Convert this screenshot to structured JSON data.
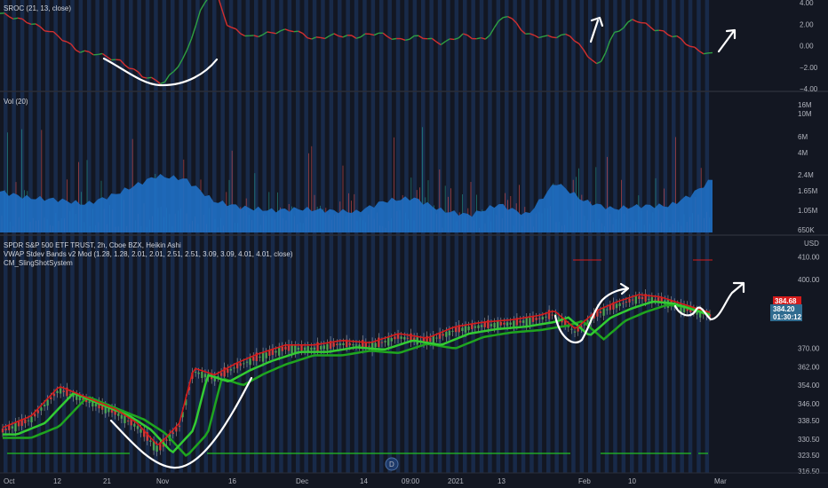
{
  "panes": {
    "sroc": {
      "title": "SROC (21, 13, close)"
    },
    "volume": {
      "title": "Vol (20)"
    },
    "price": {
      "title": "SPDR S&P 500 ETF TRUST, 2h, Cboe BZX, Heikin Ashi",
      "subtitle1": "VWAP Stdev Bands v2 Mod (1.28, 1.28, 2.01, 2.01, 2.51, 2.51, 3.09, 3.09, 4.01, 4.01, close)",
      "subtitle2": "CM_SlingShotSystem",
      "currency": "USD",
      "last_price_label": "384.68",
      "current_price_label": "384.20",
      "countdown_label": "01:30:12"
    }
  },
  "time_axis": {
    "labels": [
      "Oct",
      "12",
      "21",
      "Nov",
      "16",
      "Dec",
      "14",
      "09:00",
      "2021",
      "13",
      "Feb",
      "10",
      "Mar"
    ],
    "badge": "D"
  },
  "colors": {
    "background": "#131722",
    "stripe": "#1e3a6a",
    "sroc_up": "#2ea043",
    "sroc_down": "#d32f2f",
    "volume_fill": "#2962ff",
    "volume_up_bar": "#26a69a",
    "volume_down_bar": "#ef5350",
    "ema_fast": "#33cc33",
    "ema_slow": "#1fa51f",
    "price_red": "#d61b1b",
    "annotation": "#ffffff",
    "grid": "#2a2e39"
  },
  "chart_data": [
    {
      "type": "line",
      "name": "SROC (21, 13, close)",
      "x": [
        0,
        0.04,
        0.08,
        0.11,
        0.14,
        0.17,
        0.2,
        0.23,
        0.26,
        0.28,
        0.3,
        0.32,
        0.35,
        0.38,
        0.41,
        0.44,
        0.47,
        0.5,
        0.53,
        0.56,
        0.59,
        0.62,
        0.65,
        0.68,
        0.71,
        0.74,
        0.77,
        0.8,
        0.82,
        0.84,
        0.86,
        0.89,
        0.92,
        0.95,
        0.98,
        1.0
      ],
      "values": [
        3.0,
        2.2,
        1.0,
        -0.5,
        -0.8,
        -1.5,
        -2.8,
        -3.5,
        -1.0,
        3.0,
        5.5,
        1.8,
        0.8,
        1.2,
        1.5,
        0.6,
        1.0,
        0.8,
        1.2,
        0.5,
        0.9,
        0.2,
        1.0,
        0.5,
        3.0,
        1.0,
        0.8,
        1.0,
        -0.5,
        -2.0,
        1.0,
        2.5,
        1.5,
        0.8,
        -0.5,
        -0.8
      ],
      "ylim": [
        -4.0,
        4.0
      ],
      "yticks": [
        4.0,
        2.0,
        0.0,
        -2.0,
        -4.0
      ],
      "ytick_labels": [
        "4.00",
        "2.00",
        "0.00",
        "−2.00",
        "−4.00"
      ]
    },
    {
      "type": "area",
      "name": "Vol (20)",
      "x": [
        0,
        0.04,
        0.08,
        0.12,
        0.16,
        0.2,
        0.22,
        0.26,
        0.3,
        0.34,
        0.38,
        0.42,
        0.46,
        0.5,
        0.54,
        0.58,
        0.62,
        0.66,
        0.7,
        0.74,
        0.78,
        0.82,
        0.86,
        0.9,
        0.94,
        0.97,
        1.0
      ],
      "values": [
        1.3,
        1.1,
        1.05,
        0.9,
        1.2,
        1.6,
        1.8,
        1.7,
        1.0,
        0.8,
        0.7,
        0.75,
        0.7,
        0.65,
        1.0,
        1.1,
        0.7,
        0.55,
        0.9,
        0.55,
        1.6,
        1.0,
        0.75,
        0.85,
        0.85,
        1.2,
        1.7
      ],
      "yticks": [
        "16M",
        "10M",
        "6M",
        "4M",
        "2.4M",
        "1.65M",
        "1.05M",
        "650K"
      ]
    },
    {
      "type": "line",
      "name": "SPDR S&P 500 ETF TRUST, 2h, Cboe BZX, Heikin Ashi",
      "x": [
        0,
        0.04,
        0.08,
        0.12,
        0.16,
        0.19,
        0.22,
        0.25,
        0.27,
        0.3,
        0.33,
        0.36,
        0.4,
        0.44,
        0.48,
        0.52,
        0.56,
        0.6,
        0.64,
        0.68,
        0.72,
        0.76,
        0.78,
        0.81,
        0.84,
        0.87,
        0.9,
        0.93,
        0.96,
        1.0
      ],
      "values": [
        334,
        339,
        352,
        347,
        342,
        336,
        326,
        336,
        360,
        357,
        362,
        366,
        370,
        370,
        372,
        371,
        375,
        373,
        378,
        380,
        381,
        383,
        385,
        377,
        385,
        389,
        392,
        391,
        388,
        384.2
      ],
      "ylim": [
        316.5,
        414
      ],
      "yticks": [
        410.0,
        400.0,
        384.68,
        384.2,
        370.0,
        362.0,
        354.0,
        346.0,
        338.5,
        330.5,
        323.5,
        316.5
      ],
      "ytick_labels": [
        "410.00",
        "400.00",
        "",
        "",
        "370.00",
        "362.00",
        "354.00",
        "346.00",
        "338.50",
        "330.50",
        "323.50",
        "316.50"
      ]
    }
  ]
}
